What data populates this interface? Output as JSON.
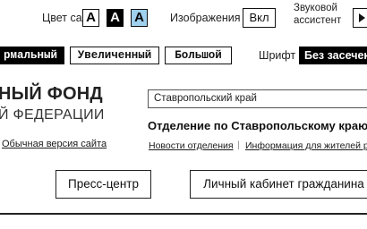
{
  "accessibility": {
    "color_label": "Цвет сайта",
    "color_options": [
      "А",
      "А",
      "А"
    ],
    "images_label": "Изображения",
    "images_toggle": "Вкл",
    "voice_label_line1": "Звуковой",
    "voice_label_line2": "ассистент",
    "size_options": [
      "рмальный",
      "Увеличенный",
      "Большой"
    ],
    "font_label": "Шрифт",
    "font_value": "Без засечек",
    "colors": {
      "blue_button": "#9fd0ee",
      "active": "#000000"
    }
  },
  "header": {
    "title_line1": "НЫЙ ФОНД",
    "title_line2": "Й ФЕДЕРАЦИИ",
    "normal_version_link": "Обычная версия сайта",
    "region_select": "Ставропольский край",
    "department": "Отделение по Ставропольскому краю",
    "links": [
      "Новости отделения",
      "Информация для жителей ре"
    ]
  },
  "buttons": {
    "press_center": "Пресс-центр",
    "citizen_cabinet": "Личный кабинет гражданина"
  }
}
